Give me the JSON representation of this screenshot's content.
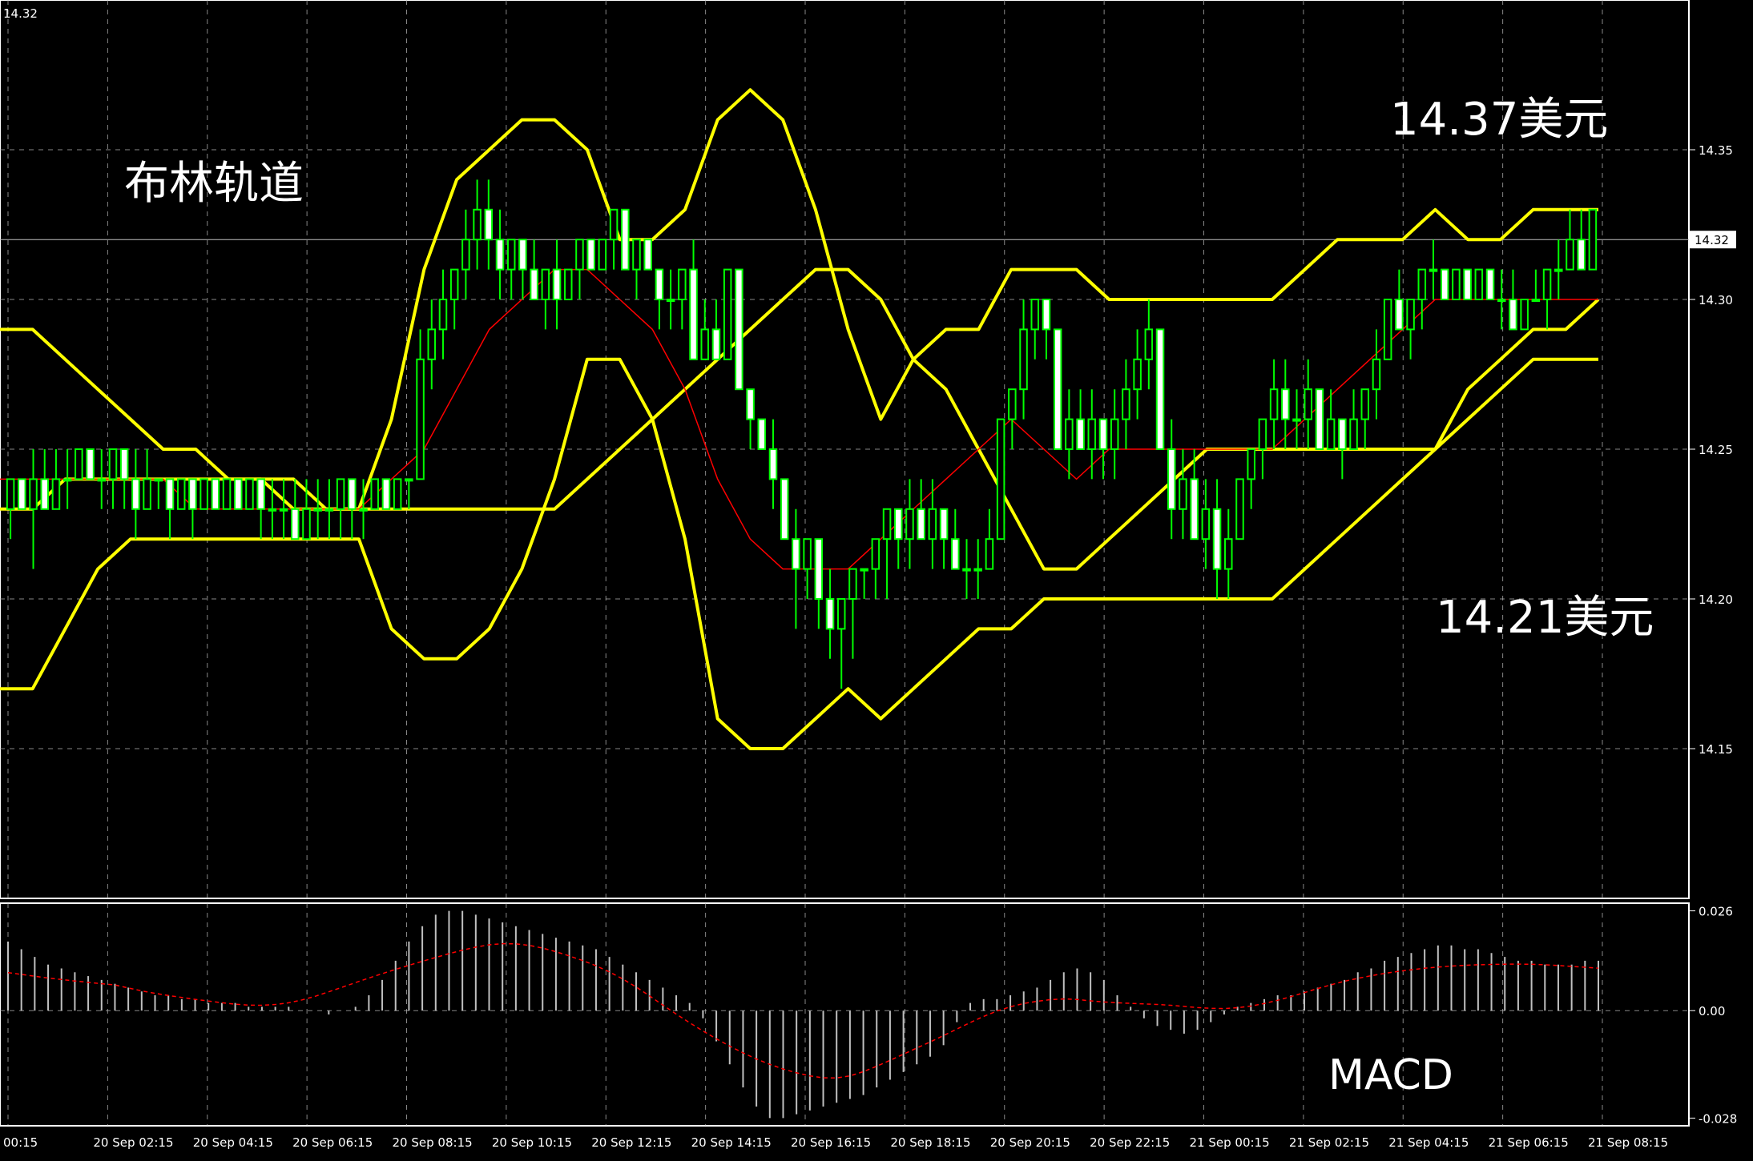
{
  "chart_data": {
    "type": "candlestick",
    "symbol_price_label": "14.32",
    "annotations": {
      "indicator_title": "布林轨道",
      "upper_target": "14.37美元",
      "lower_target": "14.21美元",
      "sub_indicator": "MACD"
    },
    "price_axis": {
      "ticks": [
        "14.35",
        "14.30",
        "14.25",
        "14.20",
        "14.15"
      ],
      "tick_values": [
        14.35,
        14.3,
        14.25,
        14.2,
        14.15
      ],
      "current_price": 14.32,
      "current_price_label": "14.32",
      "range": [
        14.1,
        14.4
      ]
    },
    "macd_axis": {
      "ticks": [
        "0.026",
        "0.00",
        "-0.028"
      ],
      "tick_values": [
        0.026,
        0.0,
        -0.028
      ],
      "range": [
        -0.03,
        0.028
      ]
    },
    "time_axis": {
      "labels": [
        "00:15",
        "20 Sep 02:15",
        "20 Sep 04:15",
        "20 Sep 06:15",
        "20 Sep 08:15",
        "20 Sep 10:15",
        "20 Sep 12:15",
        "20 Sep 14:15",
        "20 Sep 16:15",
        "20 Sep 18:15",
        "20 Sep 20:15",
        "20 Sep 22:15",
        "21 Sep 00:15",
        "21 Sep 02:15",
        "21 Sep 04:15",
        "21 Sep 06:15",
        "21 Sep 08:15"
      ]
    },
    "candles": [
      [
        14.23,
        14.24,
        14.22,
        14.24
      ],
      [
        14.24,
        14.24,
        14.23,
        14.23
      ],
      [
        14.23,
        14.25,
        14.21,
        14.24
      ],
      [
        14.24,
        14.25,
        14.23,
        14.23
      ],
      [
        14.23,
        14.25,
        14.23,
        14.24
      ],
      [
        14.24,
        14.25,
        14.23,
        14.24
      ],
      [
        14.24,
        14.25,
        14.24,
        14.25
      ],
      [
        14.25,
        14.25,
        14.24,
        14.24
      ],
      [
        14.24,
        14.25,
        14.23,
        14.24
      ],
      [
        14.24,
        14.25,
        14.23,
        14.25
      ],
      [
        14.25,
        14.25,
        14.23,
        14.24
      ],
      [
        14.24,
        14.25,
        14.22,
        14.23
      ],
      [
        14.23,
        14.25,
        14.23,
        14.24
      ],
      [
        14.24,
        14.24,
        14.23,
        14.24
      ],
      [
        14.24,
        14.24,
        14.22,
        14.23
      ],
      [
        14.23,
        14.24,
        14.23,
        14.24
      ],
      [
        14.24,
        14.24,
        14.22,
        14.23
      ],
      [
        14.23,
        14.24,
        14.23,
        14.24
      ],
      [
        14.24,
        14.24,
        14.23,
        14.23
      ],
      [
        14.23,
        14.24,
        14.23,
        14.24
      ],
      [
        14.24,
        14.24,
        14.23,
        14.23
      ],
      [
        14.23,
        14.24,
        14.23,
        14.24
      ],
      [
        14.24,
        14.24,
        14.22,
        14.23
      ],
      [
        14.23,
        14.24,
        14.22,
        14.23
      ],
      [
        14.23,
        14.24,
        14.22,
        14.23
      ],
      [
        14.23,
        14.24,
        14.22,
        14.22
      ],
      [
        14.22,
        14.24,
        14.22,
        14.23
      ],
      [
        14.23,
        14.24,
        14.22,
        14.23
      ],
      [
        14.23,
        14.24,
        14.22,
        14.23
      ],
      [
        14.23,
        14.24,
        14.22,
        14.24
      ],
      [
        14.24,
        14.24,
        14.22,
        14.23
      ],
      [
        14.23,
        14.24,
        14.22,
        14.23
      ],
      [
        14.23,
        14.24,
        14.23,
        14.24
      ],
      [
        14.24,
        14.24,
        14.23,
        14.23
      ],
      [
        14.23,
        14.24,
        14.23,
        14.24
      ],
      [
        14.24,
        14.24,
        14.23,
        14.24
      ],
      [
        14.24,
        14.29,
        14.24,
        14.28
      ],
      [
        14.28,
        14.3,
        14.27,
        14.29
      ],
      [
        14.29,
        14.31,
        14.28,
        14.3
      ],
      [
        14.3,
        14.31,
        14.29,
        14.31
      ],
      [
        14.31,
        14.33,
        14.3,
        14.32
      ],
      [
        14.32,
        14.34,
        14.31,
        14.33
      ],
      [
        14.33,
        14.34,
        14.31,
        14.32
      ],
      [
        14.32,
        14.33,
        14.3,
        14.31
      ],
      [
        14.31,
        14.32,
        14.3,
        14.32
      ],
      [
        14.32,
        14.32,
        14.3,
        14.31
      ],
      [
        14.31,
        14.32,
        14.3,
        14.3
      ],
      [
        14.3,
        14.31,
        14.29,
        14.31
      ],
      [
        14.31,
        14.32,
        14.29,
        14.3
      ],
      [
        14.3,
        14.31,
        14.3,
        14.31
      ],
      [
        14.31,
        14.32,
        14.3,
        14.32
      ],
      [
        14.32,
        14.32,
        14.31,
        14.31
      ],
      [
        14.31,
        14.32,
        14.31,
        14.32
      ],
      [
        14.32,
        14.33,
        14.31,
        14.33
      ],
      [
        14.33,
        14.33,
        14.31,
        14.31
      ],
      [
        14.31,
        14.32,
        14.3,
        14.32
      ],
      [
        14.32,
        14.32,
        14.31,
        14.31
      ],
      [
        14.31,
        14.31,
        14.29,
        14.3
      ],
      [
        14.3,
        14.31,
        14.29,
        14.3
      ],
      [
        14.3,
        14.31,
        14.29,
        14.31
      ],
      [
        14.31,
        14.32,
        14.3,
        14.28
      ],
      [
        14.28,
        14.3,
        14.28,
        14.29
      ],
      [
        14.29,
        14.3,
        14.28,
        14.28
      ],
      [
        14.28,
        14.31,
        14.28,
        14.31
      ],
      [
        14.31,
        14.31,
        14.27,
        14.27
      ],
      [
        14.27,
        14.27,
        14.25,
        14.26
      ],
      [
        14.26,
        14.26,
        14.25,
        14.25
      ],
      [
        14.25,
        14.26,
        14.23,
        14.24
      ],
      [
        14.24,
        14.24,
        14.22,
        14.22
      ],
      [
        14.22,
        14.23,
        14.19,
        14.21
      ],
      [
        14.21,
        14.22,
        14.2,
        14.22
      ],
      [
        14.22,
        14.22,
        14.19,
        14.2
      ],
      [
        14.2,
        14.21,
        14.18,
        14.19
      ],
      [
        14.19,
        14.2,
        14.17,
        14.2
      ],
      [
        14.2,
        14.21,
        14.18,
        14.21
      ],
      [
        14.21,
        14.21,
        14.2,
        14.21
      ],
      [
        14.21,
        14.22,
        14.2,
        14.22
      ],
      [
        14.22,
        14.23,
        14.2,
        14.23
      ],
      [
        14.23,
        14.23,
        14.21,
        14.22
      ],
      [
        14.22,
        14.24,
        14.21,
        14.23
      ],
      [
        14.23,
        14.24,
        14.22,
        14.22
      ],
      [
        14.22,
        14.24,
        14.21,
        14.23
      ],
      [
        14.23,
        14.23,
        14.21,
        14.22
      ],
      [
        14.22,
        14.23,
        14.21,
        14.21
      ],
      [
        14.21,
        14.22,
        14.2,
        14.21
      ],
      [
        14.21,
        14.22,
        14.2,
        14.21
      ],
      [
        14.21,
        14.23,
        14.21,
        14.22
      ],
      [
        14.22,
        14.26,
        14.22,
        14.26
      ],
      [
        14.26,
        14.27,
        14.25,
        14.27
      ],
      [
        14.27,
        14.3,
        14.26,
        14.29
      ],
      [
        14.29,
        14.3,
        14.28,
        14.3
      ],
      [
        14.3,
        14.3,
        14.28,
        14.29
      ],
      [
        14.29,
        14.29,
        14.25,
        14.25
      ],
      [
        14.25,
        14.27,
        14.24,
        14.26
      ],
      [
        14.26,
        14.27,
        14.25,
        14.25
      ],
      [
        14.25,
        14.27,
        14.24,
        14.26
      ],
      [
        14.26,
        14.26,
        14.24,
        14.25
      ],
      [
        14.25,
        14.27,
        14.24,
        14.26
      ],
      [
        14.26,
        14.28,
        14.25,
        14.27
      ],
      [
        14.27,
        14.29,
        14.26,
        14.28
      ],
      [
        14.28,
        14.3,
        14.27,
        14.29
      ],
      [
        14.29,
        14.29,
        14.25,
        14.25
      ],
      [
        14.25,
        14.26,
        14.22,
        14.23
      ],
      [
        14.23,
        14.25,
        14.22,
        14.24
      ],
      [
        14.24,
        14.25,
        14.22,
        14.22
      ],
      [
        14.22,
        14.24,
        14.21,
        14.23
      ],
      [
        14.23,
        14.24,
        14.2,
        14.21
      ],
      [
        14.21,
        14.23,
        14.2,
        14.22
      ],
      [
        14.22,
        14.24,
        14.22,
        14.24
      ],
      [
        14.24,
        14.25,
        14.23,
        14.25
      ],
      [
        14.25,
        14.26,
        14.24,
        14.26
      ],
      [
        14.26,
        14.28,
        14.25,
        14.27
      ],
      [
        14.27,
        14.28,
        14.25,
        14.26
      ],
      [
        14.26,
        14.27,
        14.25,
        14.26
      ],
      [
        14.26,
        14.28,
        14.25,
        14.27
      ],
      [
        14.27,
        14.27,
        14.25,
        14.25
      ],
      [
        14.25,
        14.27,
        14.25,
        14.26
      ],
      [
        14.26,
        14.26,
        14.24,
        14.25
      ],
      [
        14.25,
        14.27,
        14.25,
        14.26
      ],
      [
        14.26,
        14.27,
        14.25,
        14.27
      ],
      [
        14.27,
        14.29,
        14.26,
        14.28
      ],
      [
        14.28,
        14.3,
        14.28,
        14.3
      ],
      [
        14.3,
        14.31,
        14.29,
        14.29
      ],
      [
        14.29,
        14.3,
        14.28,
        14.3
      ],
      [
        14.3,
        14.31,
        14.29,
        14.31
      ],
      [
        14.31,
        14.32,
        14.3,
        14.31
      ],
      [
        14.31,
        14.31,
        14.3,
        14.3
      ],
      [
        14.3,
        14.31,
        14.3,
        14.31
      ],
      [
        14.31,
        14.31,
        14.3,
        14.3
      ],
      [
        14.3,
        14.31,
        14.3,
        14.31
      ],
      [
        14.31,
        14.31,
        14.3,
        14.3
      ],
      [
        14.3,
        14.31,
        14.29,
        14.3
      ],
      [
        14.3,
        14.31,
        14.29,
        14.29
      ],
      [
        14.29,
        14.3,
        14.29,
        14.3
      ],
      [
        14.3,
        14.31,
        14.3,
        14.3
      ],
      [
        14.3,
        14.31,
        14.29,
        14.31
      ],
      [
        14.31,
        14.32,
        14.3,
        14.31
      ],
      [
        14.31,
        14.33,
        14.31,
        14.32
      ],
      [
        14.32,
        14.33,
        14.31,
        14.31
      ],
      [
        14.31,
        14.33,
        14.31,
        14.33
      ]
    ],
    "bollinger": {
      "middle": [
        14.23,
        14.23,
        14.24,
        14.24,
        14.24,
        14.24,
        14.24,
        14.24,
        14.24,
        14.24,
        14.23,
        14.23,
        14.23,
        14.23,
        14.23,
        14.23,
        14.23,
        14.23,
        14.24,
        14.25,
        14.26,
        14.27,
        14.28,
        14.29,
        14.3,
        14.31,
        14.31,
        14.3,
        14.28,
        14.27,
        14.25,
        14.23,
        14.21,
        14.21,
        14.22,
        14.23,
        14.24,
        14.25,
        14.25,
        14.25,
        14.25,
        14.25,
        14.25,
        14.25,
        14.25,
        14.27,
        14.28,
        14.29,
        14.29,
        14.3
      ],
      "upper": [
        14.29,
        14.29,
        14.28,
        14.27,
        14.26,
        14.25,
        14.25,
        14.24,
        14.24,
        14.23,
        14.23,
        14.23,
        14.26,
        14.31,
        14.34,
        14.35,
        14.36,
        14.36,
        14.35,
        14.32,
        14.32,
        14.33,
        14.36,
        14.37,
        14.36,
        14.33,
        14.29,
        14.26,
        14.28,
        14.29,
        14.29,
        14.31,
        14.31,
        14.31,
        14.3,
        14.3,
        14.3,
        14.3,
        14.3,
        14.3,
        14.31,
        14.32,
        14.32,
        14.32,
        14.33,
        14.32,
        14.32,
        14.33,
        14.33,
        14.33
      ],
      "lower": [
        14.17,
        14.17,
        14.19,
        14.21,
        14.22,
        14.22,
        14.22,
        14.22,
        14.22,
        14.22,
        14.22,
        14.22,
        14.19,
        14.18,
        14.18,
        14.19,
        14.21,
        14.24,
        14.28,
        14.28,
        14.26,
        14.22,
        14.16,
        14.15,
        14.15,
        14.16,
        14.17,
        14.16,
        14.17,
        14.18,
        14.19,
        14.19,
        14.2,
        14.2,
        14.2,
        14.2,
        14.2,
        14.2,
        14.2,
        14.2,
        14.21,
        14.22,
        14.23,
        14.24,
        14.25,
        14.26,
        14.27,
        14.28,
        14.28,
        14.28
      ]
    },
    "moving_average_red": [
      14.24,
      14.24,
      14.24,
      14.24,
      14.24,
      14.24,
      14.23,
      14.23,
      14.23,
      14.23,
      14.23,
      14.23,
      14.24,
      14.25,
      14.27,
      14.29,
      14.3,
      14.31,
      14.31,
      14.3,
      14.29,
      14.27,
      14.24,
      14.22,
      14.21,
      14.21,
      14.21,
      14.22,
      14.23,
      14.24,
      14.25,
      14.26,
      14.25,
      14.24,
      14.25,
      14.25,
      14.25,
      14.25,
      14.25,
      14.25,
      14.26,
      14.27,
      14.28,
      14.29,
      14.3,
      14.3,
      14.3,
      14.3,
      14.3,
      14.3
    ],
    "macd": {
      "histogram": [
        0.018,
        0.016,
        0.014,
        0.012,
        0.011,
        0.01,
        0.009,
        0.008,
        0.007,
        0.006,
        0.005,
        0.004,
        0.004,
        0.003,
        0.003,
        0.002,
        0.002,
        0.002,
        0.001,
        0.001,
        0.001,
        0.001,
        0.0,
        0.0,
        -0.001,
        0.0,
        0.001,
        0.004,
        0.008,
        0.013,
        0.018,
        0.022,
        0.025,
        0.026,
        0.026,
        0.025,
        0.024,
        0.023,
        0.022,
        0.021,
        0.02,
        0.019,
        0.018,
        0.017,
        0.016,
        0.014,
        0.012,
        0.01,
        0.008,
        0.006,
        0.004,
        0.002,
        -0.002,
        -0.008,
        -0.014,
        -0.02,
        -0.025,
        -0.028,
        -0.028,
        -0.027,
        -0.026,
        -0.025,
        -0.024,
        -0.023,
        -0.022,
        -0.02,
        -0.018,
        -0.016,
        -0.014,
        -0.012,
        -0.009,
        -0.003,
        0.002,
        0.003,
        0.003,
        0.004,
        0.005,
        0.006,
        0.008,
        0.01,
        0.011,
        0.01,
        0.008,
        0.004,
        0.001,
        -0.002,
        -0.004,
        -0.005,
        -0.006,
        -0.005,
        -0.003,
        -0.001,
        0.001,
        0.002,
        0.003,
        0.004,
        0.004,
        0.005,
        0.006,
        0.007,
        0.008,
        0.01,
        0.011,
        0.013,
        0.014,
        0.015,
        0.016,
        0.017,
        0.017,
        0.016,
        0.016,
        0.015,
        0.014,
        0.013,
        0.013,
        0.012,
        0.012,
        0.012,
        0.013,
        0.013
      ]
    },
    "colors": {
      "background": "#000000",
      "grid": "#c0c0c0",
      "bull_candle": "#000000",
      "bull_candle_border": "#00ff00",
      "bear_candle": "#ffffff",
      "bear_candle_border": "#00ff00",
      "wick": "#00ff00",
      "bollinger": "#ffff00",
      "moving_average": "#ff0000",
      "macd_histogram": "#c0c0c0",
      "macd_signal": "#ff0000",
      "text": "#ffffff"
    }
  }
}
